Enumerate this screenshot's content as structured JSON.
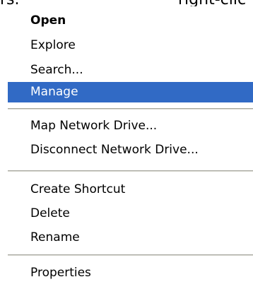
{
  "top_text": {
    "left": "rs.",
    "right": "right-clic"
  },
  "context_menu": {
    "items": [
      "Open",
      "Explore",
      "Search...",
      "Manage",
      "Map Network Drive...",
      "Disconnect Network Drive...",
      "Create Shortcut",
      "Delete",
      "Rename",
      "Properties"
    ],
    "highlighted_item": "Manage",
    "default_item": "Open"
  },
  "colors": {
    "highlight": "#316ac5",
    "separator": "#a8a8a0"
  }
}
